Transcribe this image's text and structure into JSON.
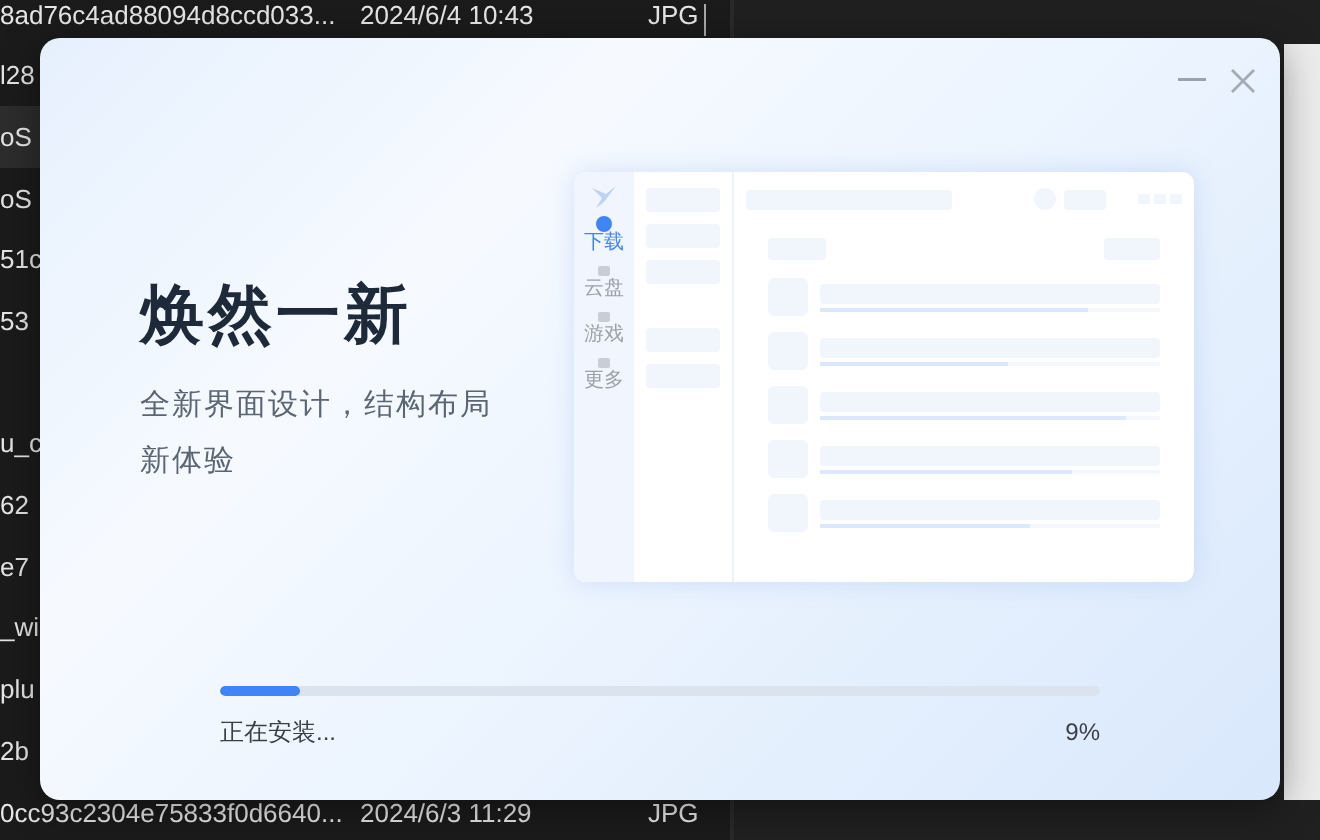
{
  "file_list": {
    "rows": [
      {
        "kind": "file",
        "name": "8ad76c4ad88094d8ccd033...",
        "date": "2024/6/4 10:43",
        "type": "JPG",
        "selected": false
      },
      {
        "kind": "file",
        "name": "l28",
        "selected": false
      },
      {
        "kind": "file",
        "name": "oS",
        "selected": true
      },
      {
        "kind": "file",
        "name": "oS",
        "selected": false
      },
      {
        "kind": "file",
        "name": "51c",
        "selected": false
      },
      {
        "kind": "file",
        "name": "53",
        "selected": false
      },
      {
        "kind": "blank"
      },
      {
        "kind": "file",
        "name": "u_c",
        "selected": false
      },
      {
        "kind": "file",
        "name": "62",
        "selected": false
      },
      {
        "kind": "file",
        "name": "e7",
        "selected": false
      },
      {
        "kind": "file",
        "name": "_wi",
        "selected": false
      },
      {
        "kind": "file",
        "name": "plu",
        "selected": false
      },
      {
        "kind": "file",
        "name": "2b",
        "selected": false
      },
      {
        "kind": "file",
        "name": "0cc93c2304e75833f0d6640...",
        "date": "2024/6/3 11:29",
        "type": "JPG",
        "selected": false
      }
    ]
  },
  "installer": {
    "title": "焕然一新",
    "subtitle": "全新界面设计，结构布局新体验",
    "preview": {
      "nav": [
        {
          "label": "下载",
          "selected": true
        },
        {
          "label": "云盘",
          "selected": false
        },
        {
          "label": "游戏",
          "selected": false
        },
        {
          "label": "更多",
          "selected": false
        }
      ],
      "rows": [
        {
          "level": 0.79
        },
        {
          "level": 0.55
        },
        {
          "level": 0.9
        },
        {
          "level": 0.74
        },
        {
          "level": 0.62
        }
      ]
    },
    "progress": {
      "level": 0.09,
      "status": "正在安装...",
      "percent": "9%"
    }
  }
}
